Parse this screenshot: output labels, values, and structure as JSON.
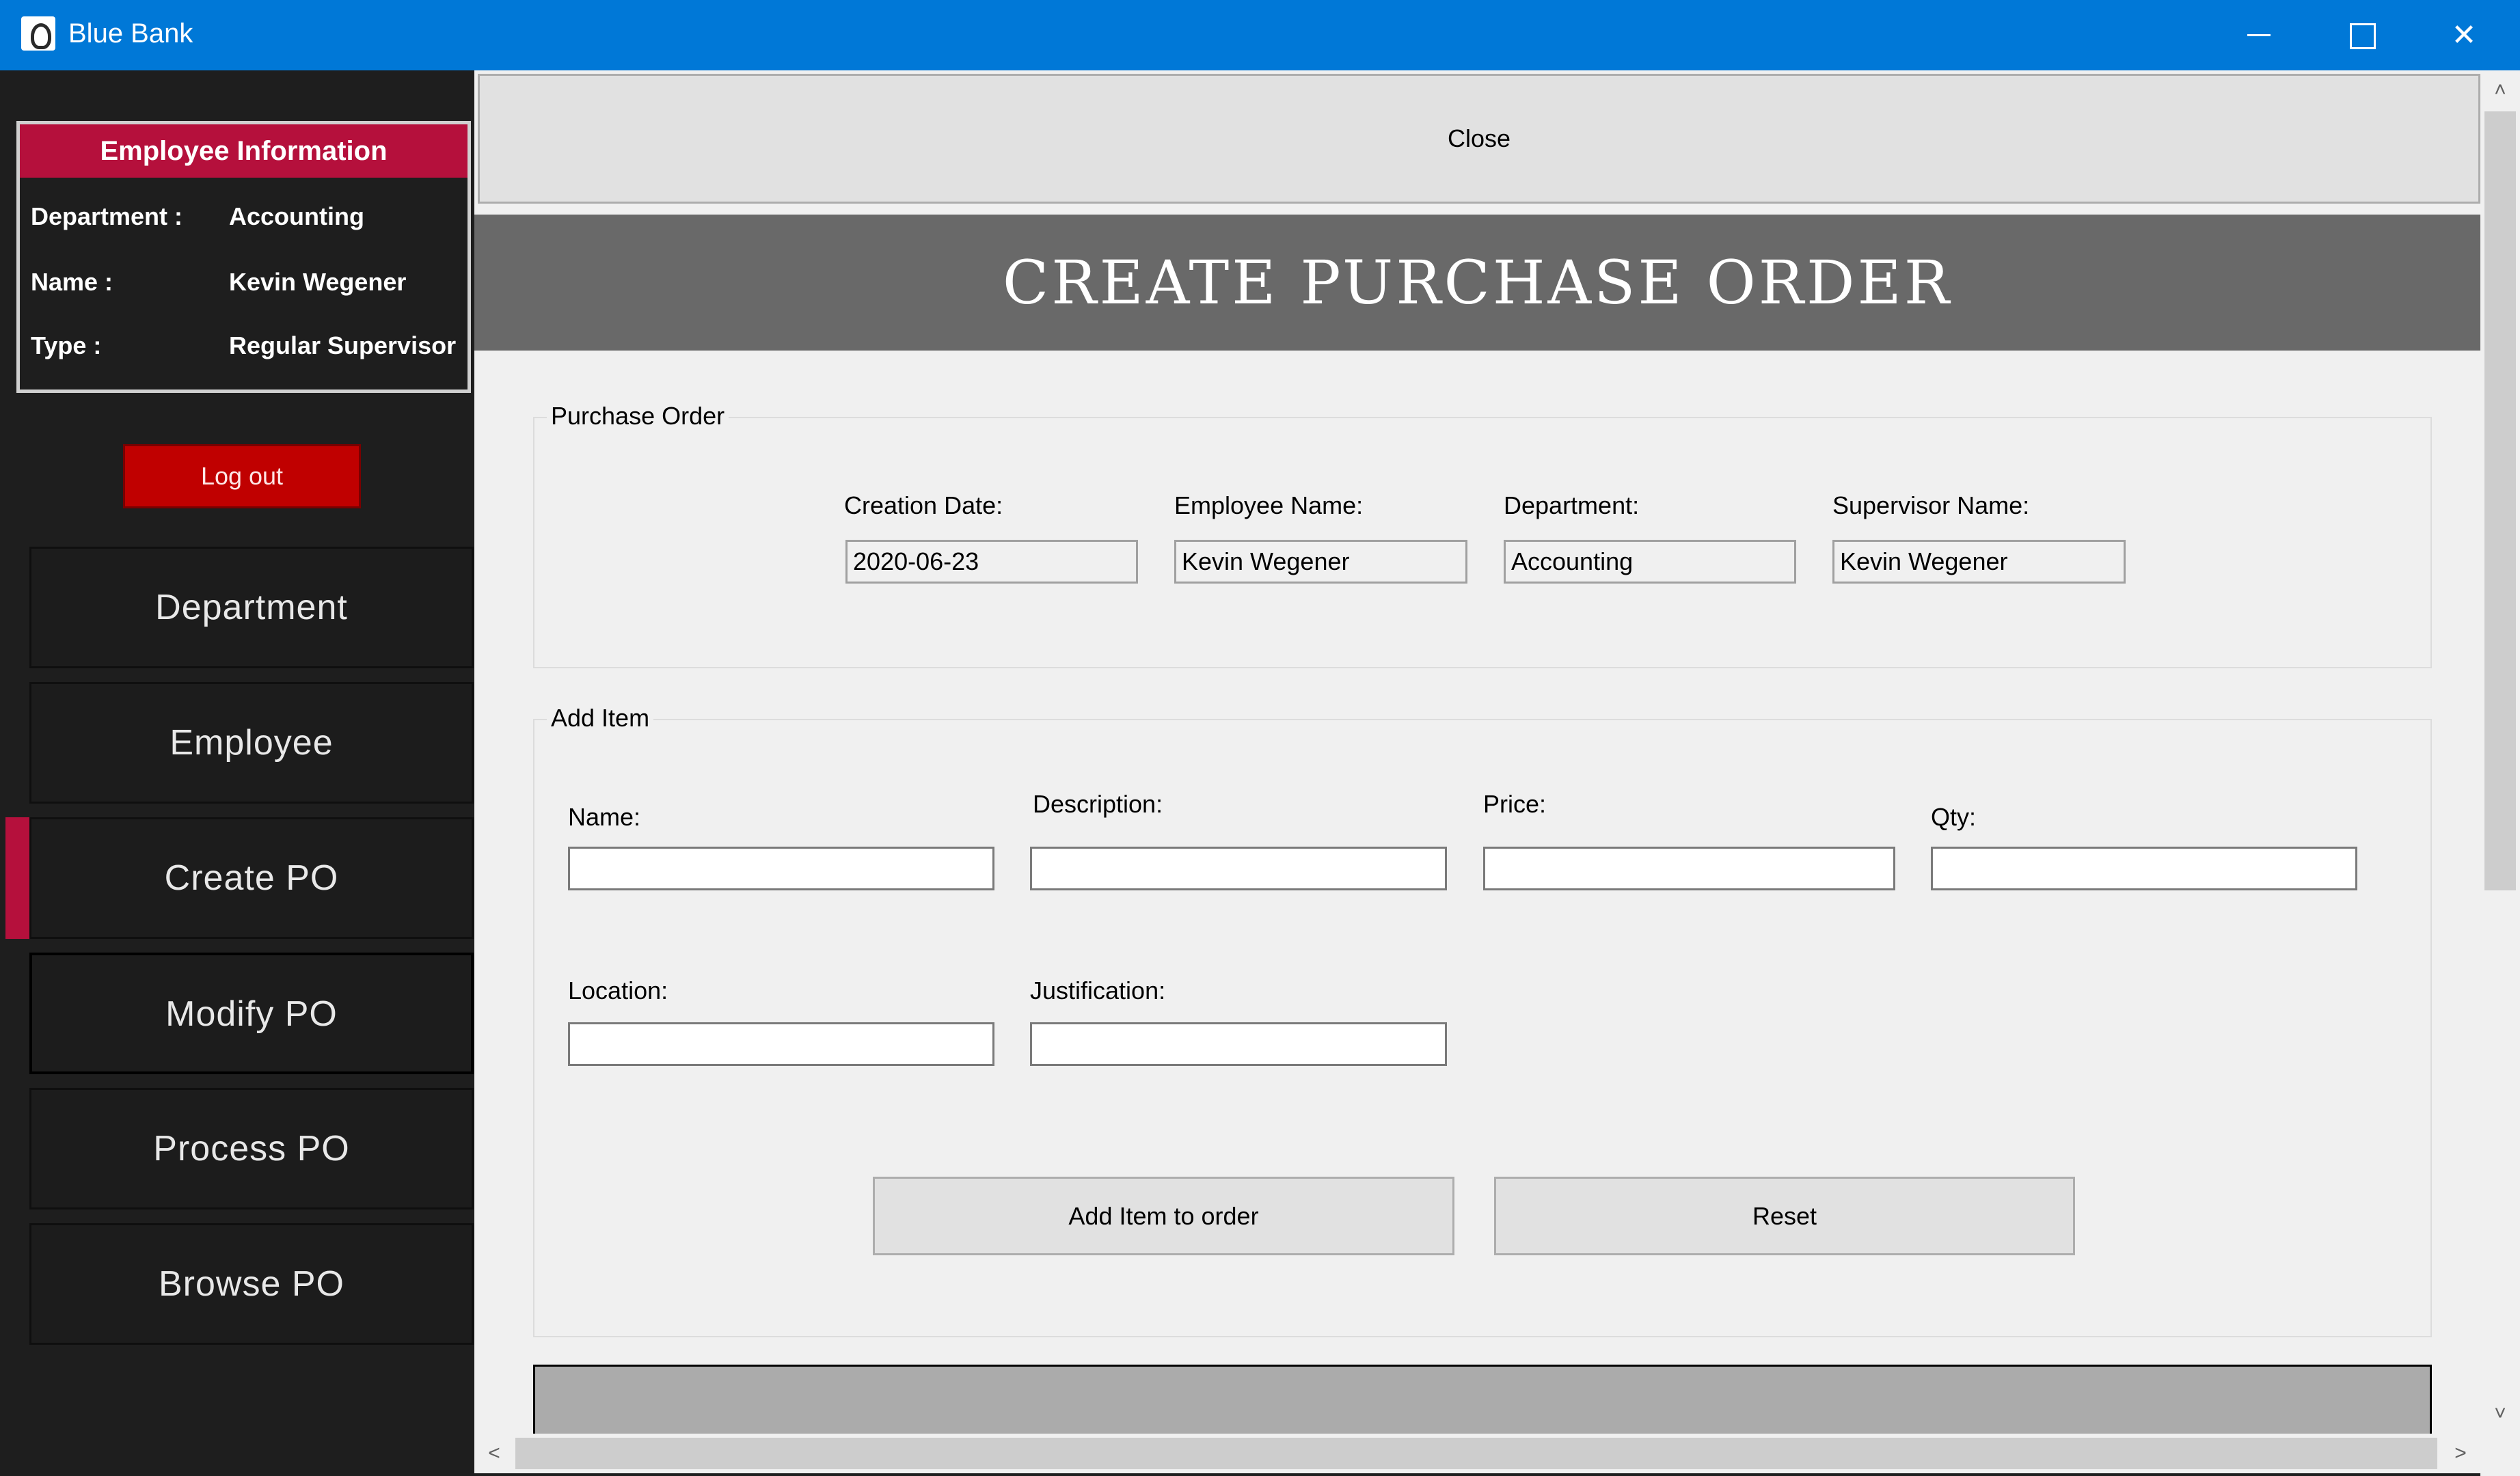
{
  "window": {
    "title": "Blue Bank",
    "icon": "app-icon",
    "controls": {
      "minimize": "minimize-icon",
      "maximize": "maximize-icon",
      "close": "✕"
    }
  },
  "sidebar": {
    "employee_info": {
      "header": "Employee Information",
      "rows": [
        {
          "label": "Department :",
          "value": "Accounting"
        },
        {
          "label": "Name :",
          "value": "Kevin Wegener"
        },
        {
          "label": "Type :",
          "value": "Regular Supervisor"
        }
      ]
    },
    "logout_label": "Log out",
    "nav": [
      {
        "label": "Department"
      },
      {
        "label": "Employee"
      },
      {
        "label": "Create PO"
      },
      {
        "label": "Modify PO"
      },
      {
        "label": "Process PO"
      },
      {
        "label": "Browse PO"
      }
    ],
    "selected_nav": "Create PO",
    "accent_color": "#b5103c"
  },
  "main": {
    "close_label": "Close",
    "banner_title": "CREATE PURCHASE ORDER",
    "purchase_order": {
      "legend": "Purchase Order",
      "fields": [
        {
          "label": "Creation Date:",
          "value": "2020-06-23"
        },
        {
          "label": "Employee Name:",
          "value": "Kevin Wegener"
        },
        {
          "label": "Department:",
          "value": "Accounting"
        },
        {
          "label": "Supervisor Name:",
          "value": "Kevin Wegener"
        }
      ]
    },
    "add_item": {
      "legend": "Add Item",
      "fields": [
        {
          "label": "Name:",
          "value": ""
        },
        {
          "label": "Description:",
          "value": ""
        },
        {
          "label": "Price:",
          "value": ""
        },
        {
          "label": "Qty:",
          "value": ""
        },
        {
          "label": "Location:",
          "value": ""
        },
        {
          "label": "Justification:",
          "value": ""
        }
      ],
      "add_button": "Add Item to order",
      "reset_button": "Reset"
    }
  },
  "scrollbars": {
    "up": "˄",
    "down": "˅",
    "left": "<",
    "right": ">"
  }
}
